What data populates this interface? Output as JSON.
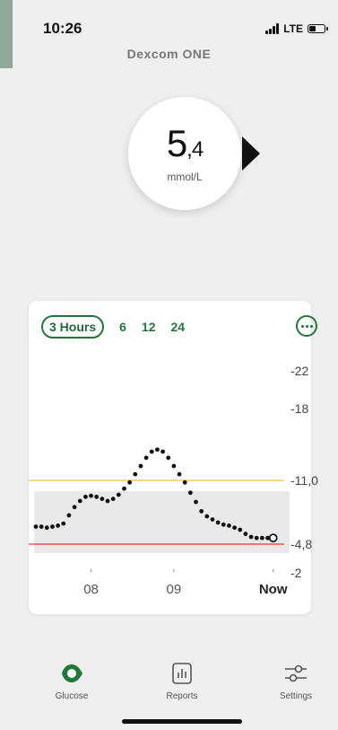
{
  "status_bar": {
    "time": "10:26",
    "network": "LTE",
    "battery_level": 0.45
  },
  "brand": "Dexcom ONE",
  "reading": {
    "value_int": "5",
    "value_dec": ",4",
    "unit": "mmol/L",
    "trend": "steady"
  },
  "chart": {
    "range_tabs": [
      {
        "label": "3 Hours",
        "active": true
      },
      {
        "label": "6",
        "active": false
      },
      {
        "label": "12",
        "active": false
      },
      {
        "label": "24",
        "active": false
      }
    ],
    "more_icon": "more-dots-icon",
    "colors": {
      "accent": "#1f7a3a",
      "high": "#e8c43a",
      "low": "#e53935",
      "range_band": "#e9e9e9"
    }
  },
  "chart_data": {
    "type": "scatter",
    "y_ticks": [
      "22",
      "18",
      "11,0",
      "4,8",
      "2"
    ],
    "x_ticks": [
      "08",
      "09",
      "Now"
    ],
    "high_threshold": 11.0,
    "low_threshold": 4.8,
    "x_range": [
      0,
      180
    ],
    "points": [
      [
        0,
        6.5
      ],
      [
        4,
        6.5
      ],
      [
        8,
        6.4
      ],
      [
        12,
        6.5
      ],
      [
        16,
        6.6
      ],
      [
        20,
        6.8
      ],
      [
        24,
        7.6
      ],
      [
        28,
        8.4
      ],
      [
        32,
        9.0
      ],
      [
        36,
        9.4
      ],
      [
        40,
        9.5
      ],
      [
        44,
        9.4
      ],
      [
        48,
        9.2
      ],
      [
        52,
        9.0
      ],
      [
        56,
        9.2
      ],
      [
        60,
        9.6
      ],
      [
        64,
        10.2
      ],
      [
        68,
        10.8
      ],
      [
        72,
        11.6
      ],
      [
        76,
        12.4
      ],
      [
        80,
        13.2
      ],
      [
        84,
        13.8
      ],
      [
        88,
        14.0
      ],
      [
        92,
        13.8
      ],
      [
        96,
        13.2
      ],
      [
        100,
        12.4
      ],
      [
        104,
        11.6
      ],
      [
        108,
        10.8
      ],
      [
        112,
        9.8
      ],
      [
        116,
        8.9
      ],
      [
        120,
        8.0
      ],
      [
        124,
        7.5
      ],
      [
        128,
        7.2
      ],
      [
        132,
        6.9
      ],
      [
        136,
        6.7
      ],
      [
        140,
        6.6
      ],
      [
        144,
        6.4
      ],
      [
        148,
        6.2
      ],
      [
        152,
        5.8
      ],
      [
        156,
        5.5
      ],
      [
        160,
        5.4
      ],
      [
        164,
        5.4
      ],
      [
        168,
        5.4
      ]
    ],
    "current_point": [
      172,
      5.4
    ]
  },
  "tab_bar": {
    "items": [
      {
        "label": "Glucose",
        "icon": "glucose-drop-icon"
      },
      {
        "label": "Reports",
        "icon": "reports-chart-icon"
      },
      {
        "label": "Settings",
        "icon": "settings-sliders-icon"
      }
    ]
  }
}
